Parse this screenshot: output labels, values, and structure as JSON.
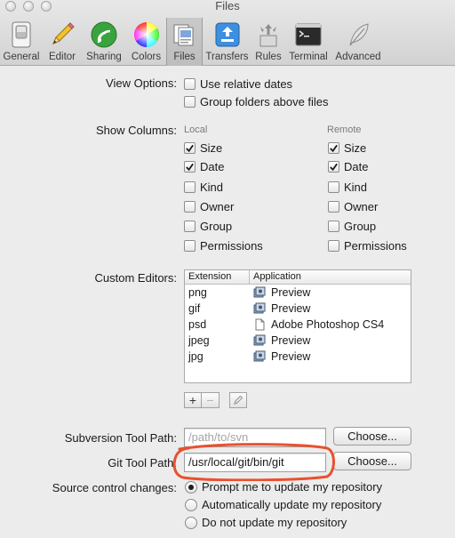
{
  "window": {
    "title": "Files"
  },
  "toolbar": {
    "items": [
      {
        "label": "General",
        "icon": "switch-icon"
      },
      {
        "label": "Editor",
        "icon": "pencil-icon"
      },
      {
        "label": "Sharing",
        "icon": "wifi-icon"
      },
      {
        "label": "Colors",
        "icon": "color-wheel-icon"
      },
      {
        "label": "Files",
        "icon": "folder-docs-icon",
        "selected": true
      },
      {
        "label": "Transfers",
        "icon": "transfer-arrows-icon"
      },
      {
        "label": "Rules",
        "icon": "rules-arrows-icon"
      },
      {
        "label": "Terminal",
        "icon": "terminal-icon"
      },
      {
        "label": "Advanced",
        "icon": "feather-icon"
      }
    ]
  },
  "view_options": {
    "label": "View Options:",
    "use_relative_dates": {
      "label": "Use relative dates",
      "checked": false
    },
    "group_folders": {
      "label": "Group folders above files",
      "checked": false
    }
  },
  "show_columns": {
    "label": "Show Columns:",
    "local_header": "Local",
    "remote_header": "Remote",
    "local": [
      {
        "label": "Size",
        "checked": true
      },
      {
        "label": "Date",
        "checked": true
      },
      {
        "label": "Kind",
        "checked": false
      },
      {
        "label": "Owner",
        "checked": false
      },
      {
        "label": "Group",
        "checked": false
      },
      {
        "label": "Permissions",
        "checked": false
      }
    ],
    "remote": [
      {
        "label": "Size",
        "checked": true
      },
      {
        "label": "Date",
        "checked": true
      },
      {
        "label": "Kind",
        "checked": false
      },
      {
        "label": "Owner",
        "checked": false
      },
      {
        "label": "Group",
        "checked": false
      },
      {
        "label": "Permissions",
        "checked": false
      }
    ]
  },
  "custom_editors": {
    "label": "Custom Editors:",
    "columns": [
      "Extension",
      "Application"
    ],
    "rows": [
      {
        "ext": "png",
        "app": "Preview",
        "icon": "preview-app-icon"
      },
      {
        "ext": "gif",
        "app": "Preview",
        "icon": "preview-app-icon"
      },
      {
        "ext": "psd",
        "app": "Adobe Photoshop CS4",
        "icon": "document-icon"
      },
      {
        "ext": "jpeg",
        "app": "Preview",
        "icon": "preview-app-icon"
      },
      {
        "ext": "jpg",
        "app": "Preview",
        "icon": "preview-app-icon"
      }
    ],
    "add": "+",
    "remove": "−"
  },
  "svn": {
    "label": "Subversion Tool Path:",
    "placeholder": "/path/to/svn",
    "value": "",
    "button": "Choose..."
  },
  "git": {
    "label": "Git Tool Path:",
    "value": "/usr/local/git/bin/git",
    "button": "Choose..."
  },
  "source_control": {
    "label": "Source control changes:",
    "options": [
      {
        "label": "Prompt me to update my repository",
        "selected": true
      },
      {
        "label": "Automatically update my repository",
        "selected": false
      },
      {
        "label": "Do not update my repository",
        "selected": false
      }
    ]
  },
  "colors": {
    "annotation": "#e8512f",
    "checkmark": "#1e1e1e"
  }
}
